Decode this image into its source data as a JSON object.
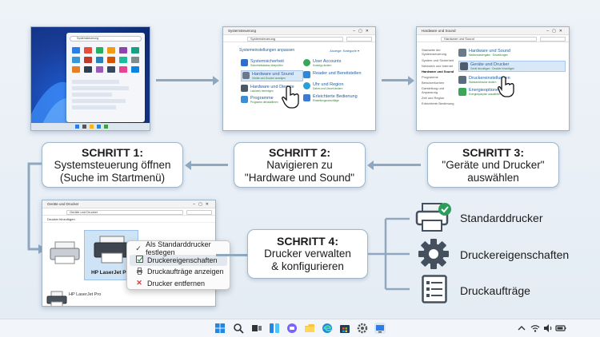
{
  "steps": [
    {
      "heading": "SCHRITT 1:",
      "line1": "Systemsteuerung öffnen",
      "line2": "(Suche im Startmenü)"
    },
    {
      "heading": "SCHRITT 2:",
      "line1": "Navigieren zu",
      "line2": "\"Hardware und Sound\""
    },
    {
      "heading": "SCHRITT 3:",
      "line1": "\"Geräte und Drucker\"",
      "line2": "auswählen"
    },
    {
      "heading": "SCHRITT 4:",
      "line1": "Drucker verwalten",
      "line2": "& konfigurieren"
    }
  ],
  "shot2": {
    "window_title": "Systemsteuerung",
    "address": "Systemsteuerung",
    "heading": "Systemeinstellungen anpassen",
    "view_by": "Anzeige: Kategorie ▾",
    "categories": [
      {
        "title": "Systemsicherheit",
        "sub": "Sicherheitsstatus überprüfen"
      },
      {
        "title": "Hardware und Sound",
        "sub": "Geräte und Drucker anzeigen"
      },
      {
        "title": "Hardware und Dienste",
        "sub": "Laufwerk bereinigen"
      },
      {
        "title": "Programme",
        "sub": "Programm deinstallieren"
      },
      {
        "title": "User Accounts",
        "sub": "Kontotyp ändern"
      },
      {
        "title": "Reader und Bereitstellen",
        "sub": ""
      },
      {
        "title": "Uhr und Region",
        "sub": "Datum und Uhrzeit ändern"
      },
      {
        "title": "Erleichterte Bedienung",
        "sub": "Einstellungsvorschläge"
      }
    ]
  },
  "shot3": {
    "window_title": "Hardware und Sound",
    "address": "Hardware und Sound",
    "sidebar": [
      "Startseite der Systemsteuerung",
      "System und Sicherheit",
      "Netzwerk und Internet",
      "Hardware und Sound",
      "Programme",
      "Benutzerkonten",
      "Darstellung und Anpassung",
      "Zeit und Region",
      "Erleichterte Bedienung"
    ],
    "sections": [
      {
        "title": "Hardware und Sound",
        "sub": "Medienwiedergabe · Einstellungen"
      },
      {
        "title": "Geräte und Drucker",
        "sub": "Gerät hinzufügen · Drucker hinzufügen"
      },
      {
        "title": "Druckereinstellungen",
        "sub": "Standarddrucker ändern"
      },
      {
        "title": "Energieoptionen",
        "sub": "Energiesparplan auswählen"
      }
    ]
  },
  "shot4": {
    "window_title": "Geräte und Drucker",
    "address": "Geräte und Drucker",
    "toolbar": "Drucker hinzufügen",
    "selected_printer": "HP LaserJet Pro",
    "bottom_printer": "HP LaserJet Pro"
  },
  "context_menu": [
    {
      "label": "Als Standarddrucker festlegen",
      "icon": "check-icon"
    },
    {
      "label": "Druckereigenschaften",
      "icon": "properties-icon"
    },
    {
      "label": "Druckaufträge anzeigen",
      "icon": "print-jobs-icon"
    },
    {
      "label": "Drucker entfernen",
      "icon": "remove-icon"
    }
  ],
  "features": [
    {
      "label": "Standarddrucker",
      "icon": "printer-check-icon"
    },
    {
      "label": "Druckereigenschaften",
      "icon": "gear-icon"
    },
    {
      "label": "Druckaufträge",
      "icon": "list-icon"
    }
  ],
  "colors": {
    "accent": "#1e5fa8",
    "arrow": "#8fa8c0",
    "check_green": "#2e9d5a",
    "remove_red": "#d23b3b"
  }
}
